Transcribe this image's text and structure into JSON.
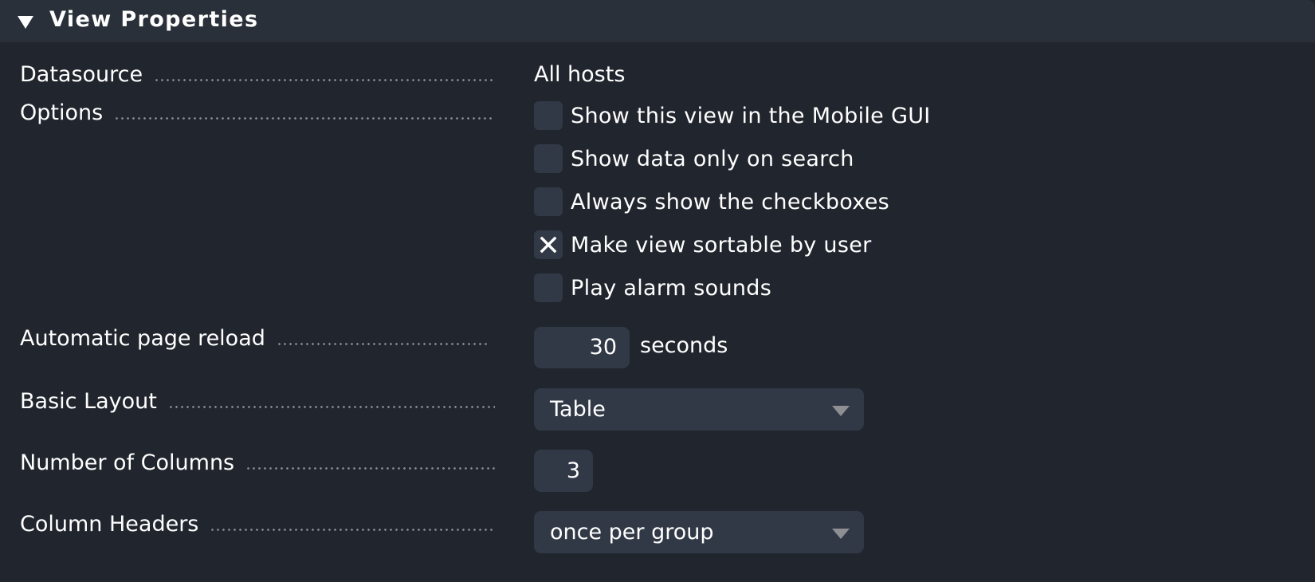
{
  "header": {
    "title": "View Properties",
    "toggle_icon": "triangle-down-icon"
  },
  "fields": {
    "datasource": {
      "label": "Datasource",
      "value": "All hosts"
    },
    "options": {
      "label": "Options",
      "checkboxes": [
        {
          "label": "Show this view in the Mobile GUI",
          "checked": false
        },
        {
          "label": "Show data only on search",
          "checked": false
        },
        {
          "label": "Always show the checkboxes",
          "checked": false
        },
        {
          "label": "Make view sortable by user",
          "checked": true
        },
        {
          "label": "Play alarm sounds",
          "checked": false
        }
      ]
    },
    "reload": {
      "label": "Automatic page reload",
      "value": "30",
      "unit": "seconds"
    },
    "layout": {
      "label": "Basic Layout",
      "value": "Table"
    },
    "columns": {
      "label": "Number of Columns",
      "value": "3"
    },
    "column_headers": {
      "label": "Column Headers",
      "value": "once per group"
    }
  },
  "colors": {
    "background": "#21262e",
    "header": "#293039",
    "control": "#323946",
    "text": "#ffffff",
    "dots": "#8a8f97"
  }
}
